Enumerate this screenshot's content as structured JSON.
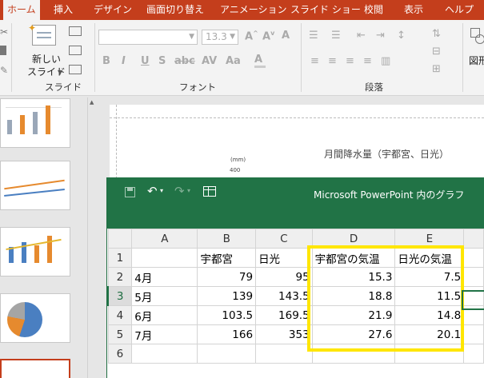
{
  "ribbon": {
    "tabs": [
      "ホーム",
      "挿入",
      "デザイン",
      "画面切り替え",
      "アニメーション",
      "スライド ショー",
      "校閲",
      "表示",
      "ヘルプ"
    ],
    "new_slide_label_1": "新しい",
    "new_slide_label_2": "スライド",
    "group_slides": "スライド",
    "group_font": "フォント",
    "group_paragraph": "段落",
    "font_size": "13.3",
    "shape_label": "図形"
  },
  "slide": {
    "chart_title": "月間降水量（宇都宮、日光）",
    "y_unit": "(mm)",
    "y_top_tick": "400"
  },
  "excel": {
    "window_title": "Microsoft PowerPoint 内のグラフ",
    "columns": [
      "A",
      "B",
      "C",
      "D",
      "E"
    ],
    "rows": [
      {
        "num": "1",
        "a": "",
        "b": "宇都宮",
        "c": "日光",
        "d": "宇都宮の気温",
        "e": "日光の気温"
      },
      {
        "num": "2",
        "a": "4月",
        "b": "79",
        "c": "95",
        "d": "15.3",
        "e": "7.5"
      },
      {
        "num": "3",
        "a": "5月",
        "b": "139",
        "c": "143.5",
        "d": "18.8",
        "e": "11.5"
      },
      {
        "num": "4",
        "a": "6月",
        "b": "103.5",
        "c": "169.5",
        "d": "21.9",
        "e": "14.8"
      },
      {
        "num": "5",
        "a": "7月",
        "b": "166",
        "c": "353",
        "d": "27.6",
        "e": "20.1"
      },
      {
        "num": "6",
        "a": "",
        "b": "",
        "c": "",
        "d": "",
        "e": ""
      }
    ]
  },
  "colors": {
    "ribbon_accent": "#c43e1c",
    "excel_green": "#217346",
    "highlight_yellow": "#ffe600"
  }
}
